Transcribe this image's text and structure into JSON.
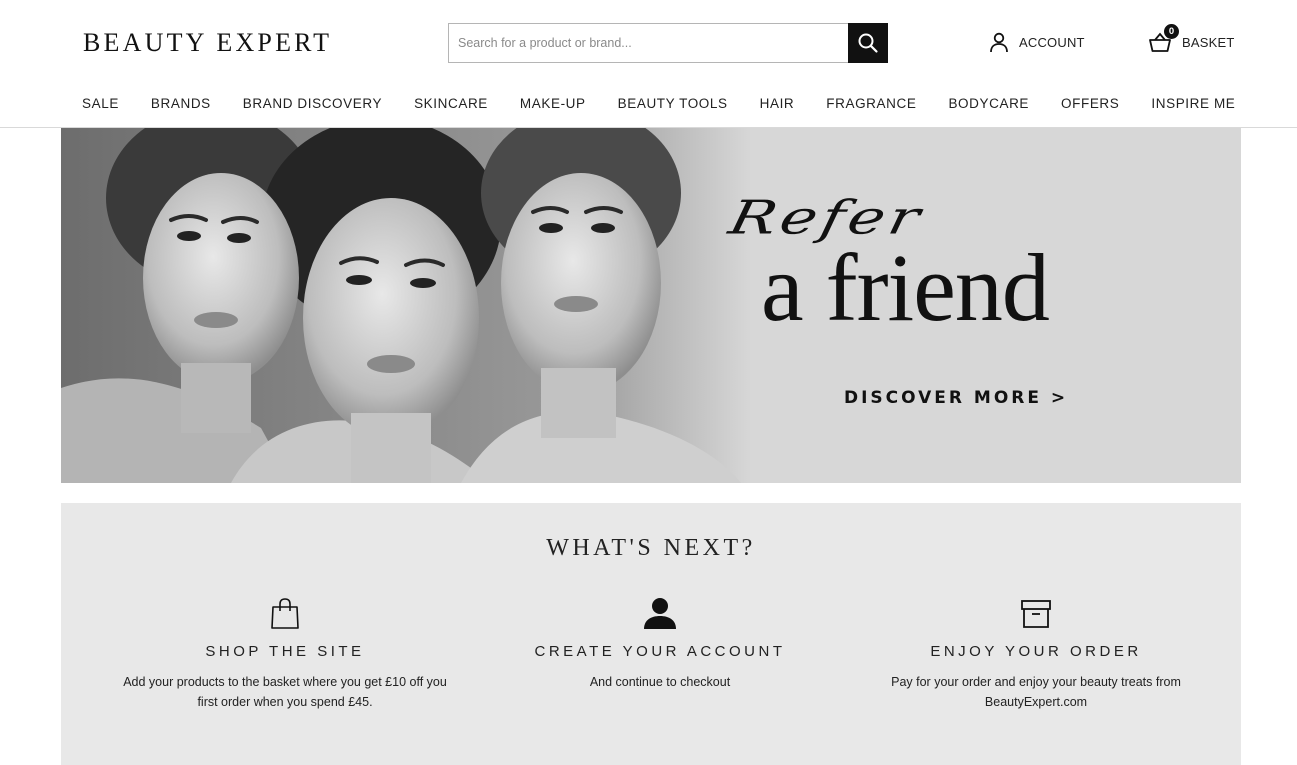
{
  "header": {
    "logo": "BEAUTY EXPERT",
    "search_placeholder": "Search for a product or brand...",
    "account_label": "ACCOUNT",
    "basket_label": "BASKET",
    "basket_count": "0"
  },
  "nav": {
    "items": [
      {
        "label": "SALE"
      },
      {
        "label": "BRANDS"
      },
      {
        "label": "BRAND DISCOVERY"
      },
      {
        "label": "SKINCARE"
      },
      {
        "label": "MAKE-UP"
      },
      {
        "label": "BEAUTY TOOLS"
      },
      {
        "label": "HAIR"
      },
      {
        "label": "FRAGRANCE"
      },
      {
        "label": "BODYCARE"
      },
      {
        "label": "OFFERS"
      },
      {
        "label": "INSPIRE ME"
      }
    ]
  },
  "hero": {
    "script_text": "Refer",
    "title": "a friend",
    "cta": "DISCOVER MORE >",
    "background_color": "#d7d7d7"
  },
  "whats_next": {
    "title": "WHAT'S NEXT?",
    "steps": [
      {
        "icon": "shopping-bag-icon",
        "title": "SHOP THE SITE",
        "text": "Add your products to the basket where you get £10 off you first order when you spend £45."
      },
      {
        "icon": "user-icon",
        "title": "CREATE YOUR ACCOUNT",
        "text": "And continue to checkout"
      },
      {
        "icon": "box-icon",
        "title": "ENJOY YOUR ORDER",
        "text": "Pay for your order and enjoy your beauty treats from BeautyExpert.com"
      }
    ]
  }
}
